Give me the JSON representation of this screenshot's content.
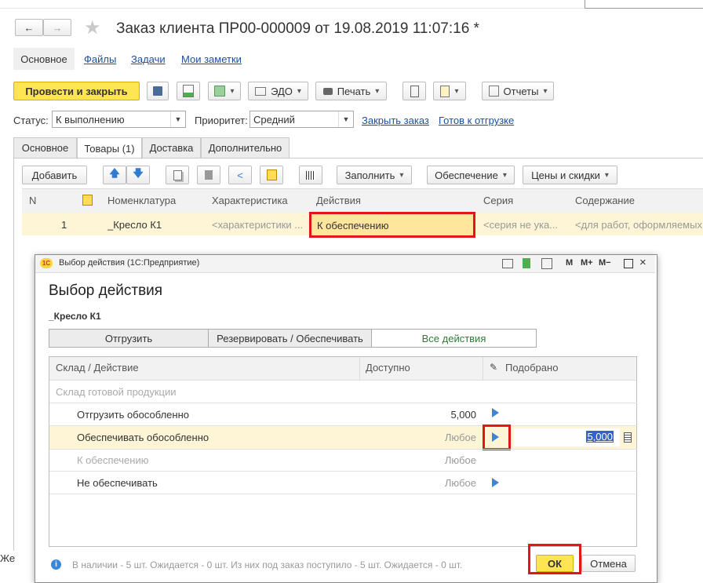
{
  "window": {
    "title": "Заказ клиента ПР00-000009 от 19.08.2019 11:07:16 *",
    "nav_back": "←",
    "nav_forward": "→",
    "star": "★"
  },
  "section_tabs": {
    "main": "Основное",
    "files": "Файлы",
    "tasks": "Задачи",
    "notes": "Мои заметки"
  },
  "toolbar": {
    "post_close": "Провести и закрыть",
    "edo": "ЭДО",
    "print": "Печать",
    "reports": "Отчеты"
  },
  "status_row": {
    "status_label": "Статус:",
    "status_value": "К выполнению",
    "priority_label": "Приоритет:",
    "priority_value": "Средний",
    "close_order": "Закрыть заказ",
    "ready_ship": "Готов к отгрузке"
  },
  "doc_tabs": [
    "Основное",
    "Товары (1)",
    "Доставка",
    "Дополнительно"
  ],
  "goods_toolbar": {
    "add": "Добавить",
    "fill": "Заполнить",
    "supply": "Обеспечение",
    "prices": "Цены и скидки"
  },
  "goods_table": {
    "headers": [
      "N",
      "Номенклатура",
      "Характеристика",
      "Действия",
      "Серия",
      "Содержание"
    ],
    "row": {
      "n": "1",
      "item": "_Кресло К1",
      "char": "<характеристики ...",
      "action": "К обеспечению",
      "series": "<серия не ука...",
      "content": "<для работ, оформляемых"
    }
  },
  "footer_left": "Же",
  "dialog": {
    "title": "Выбор действия  (1С:Предприятие)",
    "app_icon": "1С",
    "m": "M",
    "m_plus": "M+",
    "m_minus": "M−",
    "heading": "Выбор действия",
    "item": "_Кресло К1",
    "segments": [
      "Отгрузить",
      "Резервировать / Обеспечивать",
      "Все действия"
    ],
    "headers": {
      "warehouse": "Склад / Действие",
      "available": "Доступно",
      "picked": "Подобрано"
    },
    "rows": [
      {
        "name": "Склад готовой продукции",
        "available": ""
      },
      {
        "name": "Отгрузить обособленно",
        "available": "5,000"
      },
      {
        "name": "Обеспечивать обособленно",
        "available": "Любое",
        "picked": "5,000"
      },
      {
        "name": "К обеспечению",
        "available": "Любое"
      },
      {
        "name": "Не обеспечивать",
        "available": "Любое"
      }
    ],
    "info": "В наличии - 5 шт. Ожидается - 0 шт. Из них под заказ поступило - 5 шт. Ожидается - 0 шт.",
    "ok": "ОК",
    "cancel": "Отмена"
  },
  "colors": {
    "accent_yellow": "#ffe552",
    "highlight_row": "#fdf5d6",
    "red_frame": "#e0161a",
    "link_blue": "#1d4e9a"
  }
}
